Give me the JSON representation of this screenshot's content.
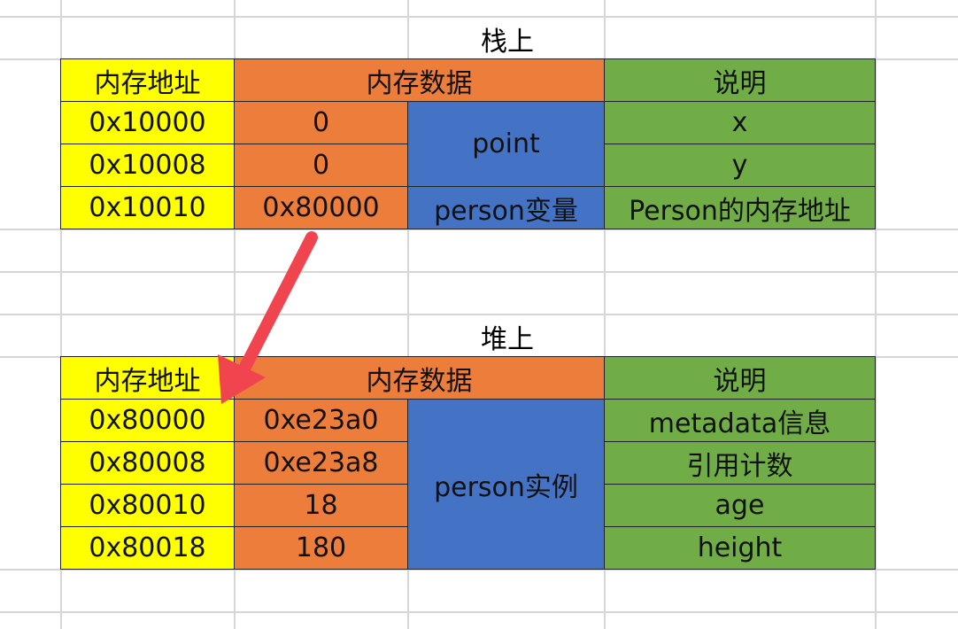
{
  "stack": {
    "title": "栈上",
    "headers": {
      "address": "内存地址",
      "data": "内存数据",
      "desc": "说明"
    },
    "rows": [
      {
        "address": "0x10000",
        "data": "0",
        "desc": "x"
      },
      {
        "address": "0x10008",
        "data": "0",
        "desc": "y"
      },
      {
        "address": "0x10010",
        "data": "0x80000",
        "desc": "Person的内存地址"
      }
    ],
    "group_labels": [
      "point",
      "person变量"
    ]
  },
  "heap": {
    "title": "堆上",
    "headers": {
      "address": "内存地址",
      "data": "内存数据",
      "desc": "说明"
    },
    "rows": [
      {
        "address": "0x80000",
        "data": "0xe23a0",
        "desc": "metadata信息"
      },
      {
        "address": "0x80008",
        "data": "0xe23a8",
        "desc": "引用计数"
      },
      {
        "address": "0x80010",
        "data": "18",
        "desc": "age"
      },
      {
        "address": "0x80018",
        "data": "180",
        "desc": "height"
      }
    ],
    "group_label": "person实例"
  },
  "colors": {
    "address": "#ffff00",
    "data": "#ed7d3b",
    "group": "#4472c4",
    "desc": "#70ad47",
    "arrow": "#f0454f",
    "gridline": "#d6d6d6"
  }
}
